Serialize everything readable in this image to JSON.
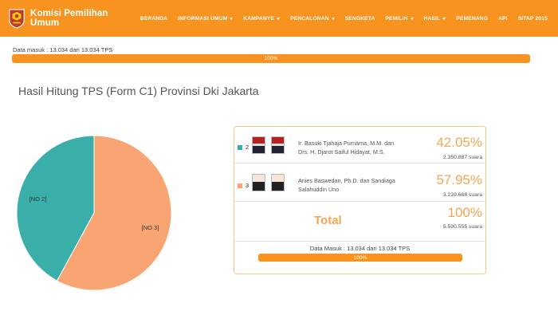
{
  "header": {
    "brand": "Komisi Pemilihan Umum",
    "nav": [
      {
        "label": "BERANDA",
        "dropdown": false,
        "name": "nav-beranda"
      },
      {
        "label": "INFORMASI UMUM",
        "dropdown": true,
        "name": "nav-informasi-umum"
      },
      {
        "label": "KAMPANYE",
        "dropdown": true,
        "name": "nav-kampanye"
      },
      {
        "label": "PENCALONAN",
        "dropdown": true,
        "name": "nav-pencalonan"
      },
      {
        "label": "SENGKETA",
        "dropdown": false,
        "name": "nav-sengketa"
      },
      {
        "label": "PEMILIH",
        "dropdown": true,
        "name": "nav-pemilih"
      },
      {
        "label": "HASIL",
        "dropdown": true,
        "name": "nav-hasil"
      },
      {
        "label": "PEMENANG",
        "dropdown": false,
        "name": "nav-pemenang"
      },
      {
        "label": "API",
        "dropdown": false,
        "name": "nav-api"
      },
      {
        "label": "SITAP 2015",
        "dropdown": false,
        "name": "nav-sitap-2015"
      }
    ],
    "color": "#f7931e"
  },
  "data_masuk": {
    "label": "Data masuk : 13.034 dari 13.034 TPS",
    "progress_label": "100%",
    "progress": 1.0
  },
  "page_title": "Hasil Hitung TPS (Form C1) Provinsi Dki Jakarta",
  "chart_data": {
    "type": "pie",
    "slices": [
      {
        "label": "[NO 2]",
        "value": 42.05,
        "color": "#3aafa9"
      },
      {
        "label": "[NO 3]",
        "value": 57.95,
        "color": "#f9a573"
      }
    ]
  },
  "results": {
    "candidates": [
      {
        "number": "2",
        "names": [
          "Ir. Basuki Tjahaja Purnama, M.M. dan",
          "Drs. H. Djarot Saiful Hidayat, M.S."
        ],
        "percent": "42.05%",
        "votes": "2.350.887 suara",
        "color": "#3aafa9"
      },
      {
        "number": "3",
        "names": [
          "Anies Baswedan, Ph.D. dan Sandiaga",
          "Salahuddin Uno"
        ],
        "percent": "57.95%",
        "votes": "3.239.668 suara",
        "color": "#f9a573"
      }
    ],
    "total": {
      "label": "Total",
      "percent": "100%",
      "votes": "5.590.555 suara"
    },
    "data_masuk": {
      "label": "Data Masuk : 13.034 dari 13.034 TPS",
      "progress_label": "100%",
      "progress": 1.0
    }
  },
  "accent_color": "#f7a552"
}
